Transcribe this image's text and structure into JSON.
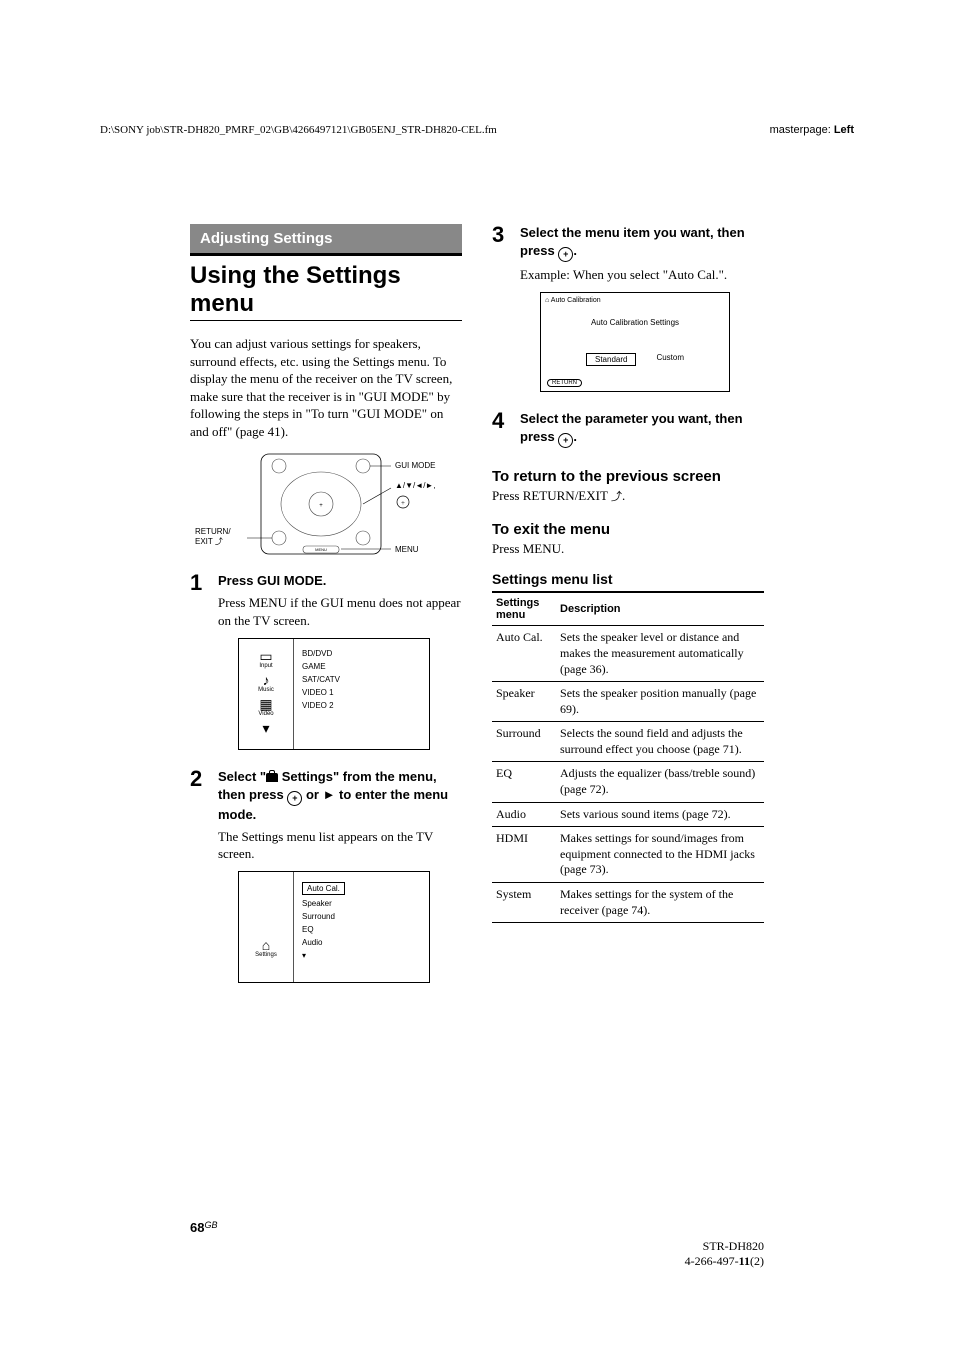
{
  "header": {
    "path": "D:\\SONY job\\STR-DH820_PMRF_02\\GB\\4266497121\\GB05ENJ_STR-DH820-CEL.fm",
    "masterpage_label": "masterpage:",
    "masterpage_value": "Left"
  },
  "left": {
    "section_tag": "Adjusting Settings",
    "h1": "Using the Settings menu",
    "intro": "You can adjust various settings for speakers, surround effects, etc. using the Settings menu. To display the menu of the receiver on the TV screen, make sure that the receiver is in \"GUI MODE\" by following the steps in \"To turn \"GUI MODE\" on and off\" (page 41).",
    "remote_labels": {
      "gui_mode": "GUI MODE",
      "arrows": "▲/▼/◄/►,",
      "return": "RETURN/\nEXIT",
      "menu": "MENU"
    },
    "steps": [
      {
        "num": "1",
        "title": "Press GUI MODE.",
        "desc": "Press MENU if the GUI menu does not appear on the TV screen."
      },
      {
        "num": "2",
        "title_pre": "Select \"",
        "title_mid": " Settings\" from the menu, then press ",
        "title_post": " or ► to enter the menu mode.",
        "desc": "The Settings menu list appears on the TV screen."
      }
    ],
    "gui1_sidebar": [
      "Input",
      "Music",
      "Video"
    ],
    "gui1_items": [
      "BD/DVD",
      "GAME",
      "SAT/CATV",
      "VIDEO 1",
      "VIDEO 2"
    ],
    "gui2_sidebar": "Settings",
    "gui2_items": [
      "Auto Cal.",
      "Speaker",
      "Surround",
      "EQ",
      "Audio"
    ]
  },
  "right": {
    "steps": [
      {
        "num": "3",
        "title_pre": "Select the menu item you want, then press ",
        "title_post": ".",
        "desc": "Example: When you select \"Auto Cal.\"."
      },
      {
        "num": "4",
        "title_pre": "Select the parameter you want, then press ",
        "title_post": "."
      }
    ],
    "autocal": {
      "title": "Auto Calibration",
      "subtitle": "Auto Calibration Settings",
      "btn1": "Standard",
      "btn2": "Custom",
      "foot": "RETURN"
    },
    "return_head": "To return to the previous screen",
    "return_body": "Press RETURN/EXIT ",
    "exit_head": "To exit the menu",
    "exit_body": "Press MENU.",
    "table_head": "Settings menu list",
    "table_cols": [
      "Settings menu",
      "Description"
    ],
    "table_rows": [
      {
        "k": "Auto Cal.",
        "v": "Sets the speaker level or distance and makes the measurement automatically (page 36)."
      },
      {
        "k": "Speaker",
        "v": "Sets the speaker position manually (page 69)."
      },
      {
        "k": "Surround",
        "v": "Selects the sound field and adjusts the surround effect you choose (page 71)."
      },
      {
        "k": "EQ",
        "v": "Adjusts the equalizer (bass/treble sound) (page 72)."
      },
      {
        "k": "Audio",
        "v": "Sets various sound items (page 72)."
      },
      {
        "k": "HDMI",
        "v": "Makes settings for sound/images from equipment connected to the HDMI jacks (page 73)."
      },
      {
        "k": "System",
        "v": "Makes settings for the system of the receiver (page 74)."
      }
    ]
  },
  "footer": {
    "page_num": "68",
    "page_suffix": "GB",
    "model": "STR-DH820",
    "code": "4-266-497-11(2)"
  }
}
